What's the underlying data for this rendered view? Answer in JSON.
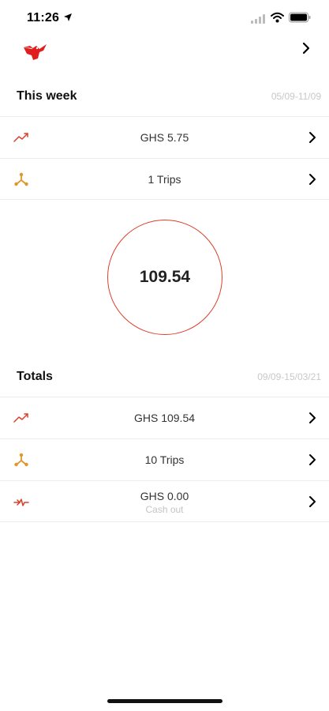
{
  "status_bar": {
    "time": "11:26"
  },
  "colors": {
    "accent": "#d9402b",
    "trips": "#e0962a",
    "divider": "#ececec",
    "muted": "#c4c4c4"
  },
  "icons": {
    "logo": "bird-logo-icon",
    "earnings": "trend-up-icon",
    "trips": "nodes-icon",
    "cashout": "cash-out-icon",
    "chevron": "chevron-right-icon"
  },
  "this_week": {
    "title": "This week",
    "range": "05/09-11/09",
    "rows": [
      {
        "label": "GHS 5.75"
      },
      {
        "label": "1 Trips"
      }
    ]
  },
  "summary_circle": {
    "value": "109.54"
  },
  "totals": {
    "title": "Totals",
    "range": "09/09-15/03/21",
    "rows": [
      {
        "label": "GHS 109.54"
      },
      {
        "label": "10 Trips"
      },
      {
        "label": "GHS 0.00",
        "sublabel": "Cash out"
      }
    ]
  }
}
